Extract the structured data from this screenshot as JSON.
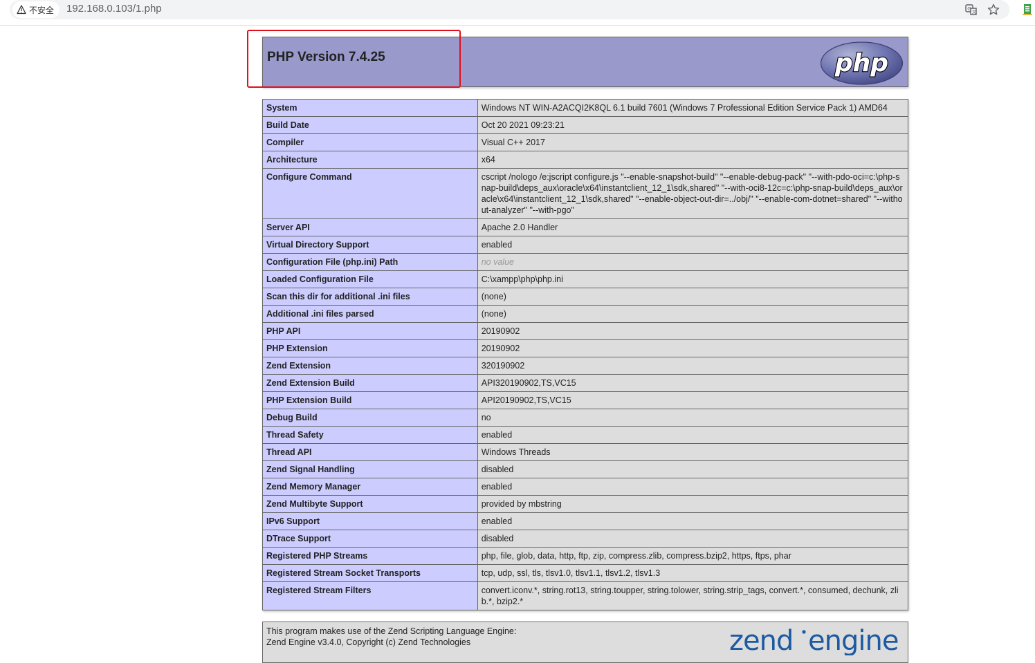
{
  "browser": {
    "security_label": "不安全",
    "url": "192.168.0.103/1.php"
  },
  "header": {
    "title": "PHP Version 7.4.25",
    "logo_text": "php"
  },
  "rows": [
    {
      "key": "System",
      "value": "Windows NT WIN-A2ACQI2K8QL 6.1 build 7601 (Windows 7 Professional Edition Service Pack 1) AMD64"
    },
    {
      "key": "Build Date",
      "value": "Oct 20 2021 09:23:21"
    },
    {
      "key": "Compiler",
      "value": "Visual C++ 2017"
    },
    {
      "key": "Architecture",
      "value": "x64"
    },
    {
      "key": "Configure Command",
      "value": "cscript /nologo /e:jscript configure.js \"--enable-snapshot-build\" \"--enable-debug-pack\" \"--with-pdo-oci=c:\\php-snap-build\\deps_aux\\oracle\\x64\\instantclient_12_1\\sdk,shared\" \"--with-oci8-12c=c:\\php-snap-build\\deps_aux\\oracle\\x64\\instantclient_12_1\\sdk,shared\" \"--enable-object-out-dir=../obj/\" \"--enable-com-dotnet=shared\" \"--without-analyzer\" \"--with-pgo\""
    },
    {
      "key": "Server API",
      "value": "Apache 2.0 Handler"
    },
    {
      "key": "Virtual Directory Support",
      "value": "enabled"
    },
    {
      "key": "Configuration File (php.ini) Path",
      "value": "no value",
      "novalue": true
    },
    {
      "key": "Loaded Configuration File",
      "value": "C:\\xampp\\php\\php.ini"
    },
    {
      "key": "Scan this dir for additional .ini files",
      "value": "(none)"
    },
    {
      "key": "Additional .ini files parsed",
      "value": "(none)"
    },
    {
      "key": "PHP API",
      "value": "20190902"
    },
    {
      "key": "PHP Extension",
      "value": "20190902"
    },
    {
      "key": "Zend Extension",
      "value": "320190902"
    },
    {
      "key": "Zend Extension Build",
      "value": "API320190902,TS,VC15"
    },
    {
      "key": "PHP Extension Build",
      "value": "API20190902,TS,VC15"
    },
    {
      "key": "Debug Build",
      "value": "no"
    },
    {
      "key": "Thread Safety",
      "value": "enabled"
    },
    {
      "key": "Thread API",
      "value": "Windows Threads"
    },
    {
      "key": "Zend Signal Handling",
      "value": "disabled"
    },
    {
      "key": "Zend Memory Manager",
      "value": "enabled"
    },
    {
      "key": "Zend Multibyte Support",
      "value": "provided by mbstring"
    },
    {
      "key": "IPv6 Support",
      "value": "enabled"
    },
    {
      "key": "DTrace Support",
      "value": "disabled"
    },
    {
      "key": "Registered PHP Streams",
      "value": "php, file, glob, data, http, ftp, zip, compress.zlib, compress.bzip2, https, ftps, phar"
    },
    {
      "key": "Registered Stream Socket Transports",
      "value": "tcp, udp, ssl, tls, tlsv1.0, tlsv1.1, tlsv1.2, tlsv1.3"
    },
    {
      "key": "Registered Stream Filters",
      "value": "convert.iconv.*, string.rot13, string.toupper, string.tolower, string.strip_tags, convert.*, consumed, dechunk, zlib.*, bzip2.*"
    }
  ],
  "zend": {
    "line1": "This program makes use of the Zend Scripting Language Engine:",
    "line2": "Zend Engine v3.4.0, Copyright (c) Zend Technologies",
    "logo_text": "zend engine"
  },
  "colors": {
    "header_bg": "#9999cc",
    "key_bg": "#ccccff",
    "value_bg": "#dddddd",
    "highlight_border": "#e1101b"
  }
}
